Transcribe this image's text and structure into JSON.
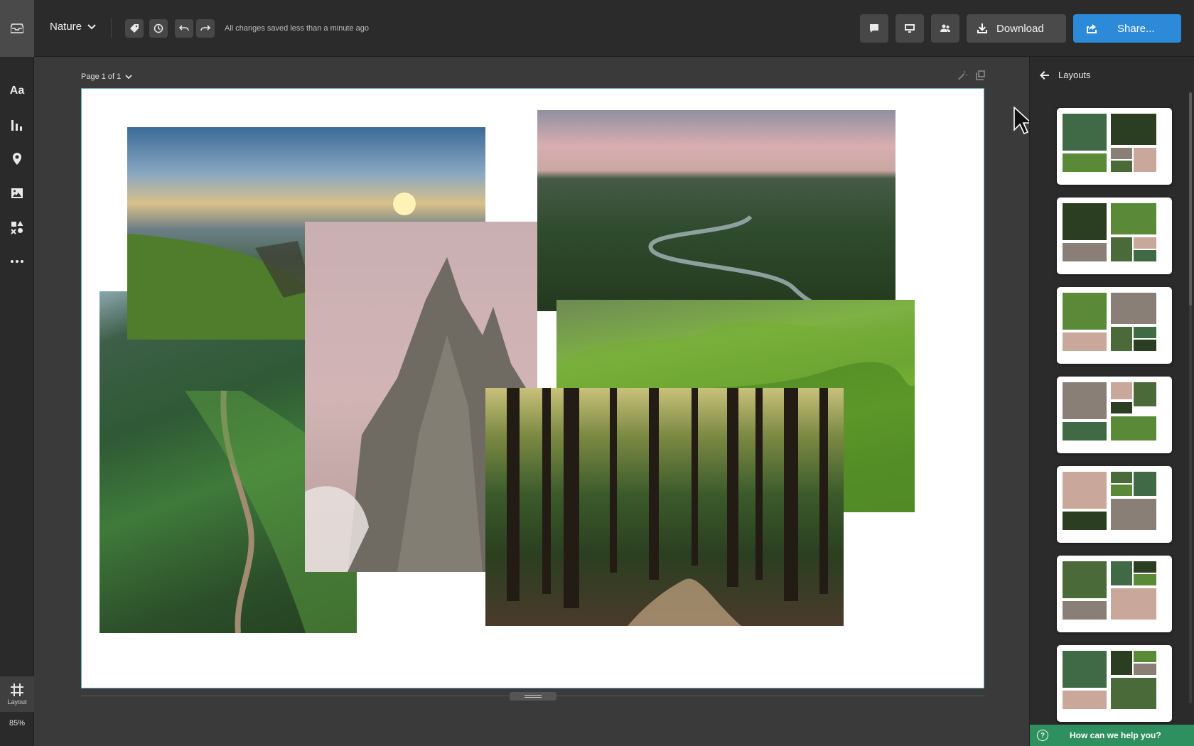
{
  "header": {
    "doc_title": "Nature",
    "saved_status": "All changes saved less than a minute ago",
    "download_label": "Download",
    "share_label": "Share..."
  },
  "rail": {
    "text_tool_label": "Aa",
    "layout_label": "Layout",
    "zoom": "85%"
  },
  "canvas": {
    "page_label": "Page 1 of 1"
  },
  "panel": {
    "title": "Layouts",
    "layout_count": 7,
    "help_label": "How can we help you?",
    "help_icon_glyph": "?"
  },
  "photos": [
    {
      "subject": "cliff-sunset"
    },
    {
      "subject": "river-aerial"
    },
    {
      "subject": "trail-ridge"
    },
    {
      "subject": "rocky-peak"
    },
    {
      "subject": "green-hills"
    },
    {
      "subject": "forest-path"
    }
  ],
  "colors": {
    "accent": "#2d8ad8",
    "help_bar": "#2e8f5f",
    "canvas_border": "#6fa9bf"
  }
}
